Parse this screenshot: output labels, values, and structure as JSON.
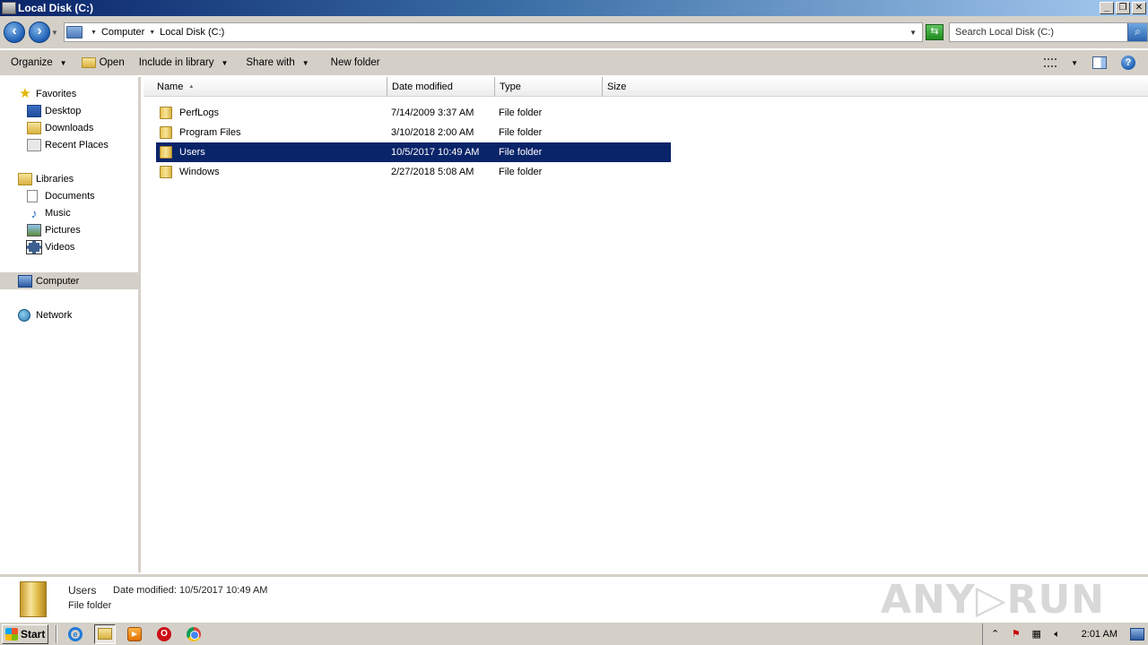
{
  "window": {
    "title": "Local Disk (C:)",
    "minimize": "_",
    "maximize": "❐",
    "close": "✕"
  },
  "address": {
    "breadcrumbs": [
      "Computer",
      "Local Disk (C:)"
    ],
    "search_placeholder": "Search Local Disk (C:)"
  },
  "toolbar": {
    "organize": "Organize",
    "open": "Open",
    "include_in_library": "Include in library",
    "share_with": "Share with",
    "new_folder": "New folder"
  },
  "nav": {
    "favorites": "Favorites",
    "desktop": "Desktop",
    "downloads": "Downloads",
    "recent_places": "Recent Places",
    "libraries": "Libraries",
    "documents": "Documents",
    "music": "Music",
    "pictures": "Pictures",
    "videos": "Videos",
    "computer": "Computer",
    "network": "Network"
  },
  "columns": {
    "name": "Name",
    "date_modified": "Date modified",
    "type": "Type",
    "size": "Size"
  },
  "files": [
    {
      "name": "PerfLogs",
      "date": "7/14/2009 3:37 AM",
      "type": "File folder"
    },
    {
      "name": "Program Files",
      "date": "3/10/2018 2:00 AM",
      "type": "File folder"
    },
    {
      "name": "Users",
      "date": "10/5/2017 10:49 AM",
      "type": "File folder"
    },
    {
      "name": "Windows",
      "date": "2/27/2018 5:08 AM",
      "type": "File folder"
    }
  ],
  "details": {
    "name": "Users",
    "date_label": "Date modified: 10/5/2017 10:49 AM",
    "type": "File folder",
    "watermark": "ANY▷RUN"
  },
  "taskbar": {
    "start": "Start",
    "clock": "2:01 AM"
  }
}
